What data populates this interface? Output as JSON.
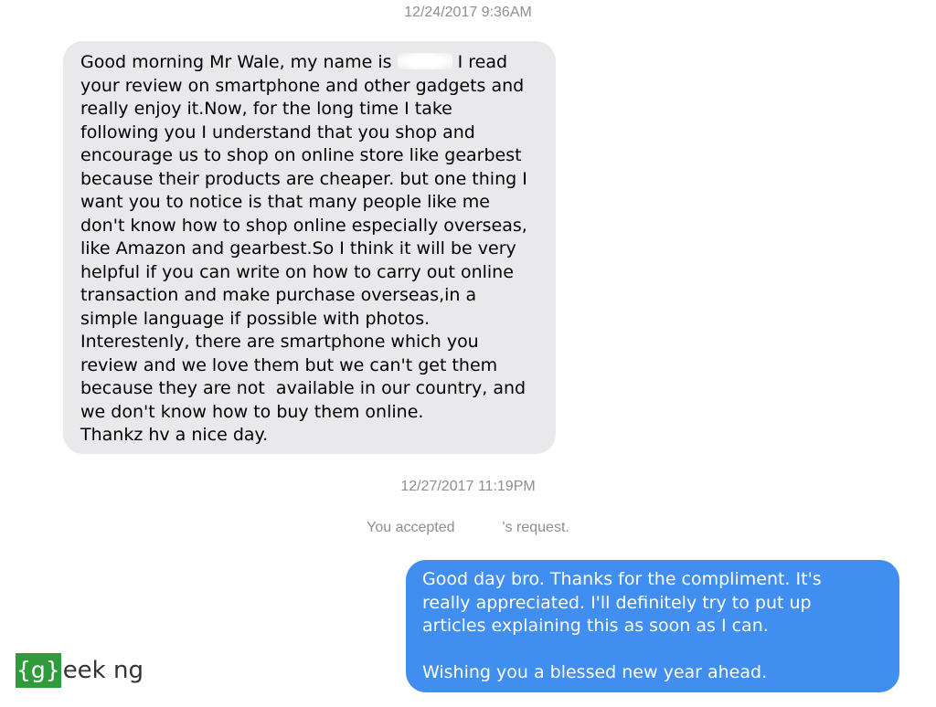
{
  "conversation": {
    "timestamp_1": "12/24/2017 9:36AM",
    "incoming_message": {
      "before_name": "Good morning Mr Wale, my name is ",
      "after_name": " I read\nyour review on smartphone and other gadgets and\nreally enjoy it.Now, for the long time I take\nfollowing you I understand that you shop and\nencourage us to shop on online store like gearbest\nbecause their products are cheaper. but one thing I\nwant you to notice is that many people like me\ndon't know how to shop online especially overseas,\nlike Amazon and gearbest.So I think it will be very\nhelpful if you can write on how to carry out online\ntransaction and make purchase overseas,in a\nsimple language if possible with photos.\nInterestenly, there are smartphone which you\nreview and we love them but we can't get them\nbecause they are not  available in our country, and\nwe don't know how to buy them online.\nThankz hv a nice day."
    },
    "timestamp_2": "12/27/2017 11:19PM",
    "system_note": {
      "before": "You accepted",
      "after": "'s request."
    },
    "outgoing_message": "Good day bro. Thanks for the compliment. It's\nreally appreciated. I'll definitely try to put up\narticles explaining this as soon as I can.\n\nWishing you a blessed new year ahead."
  },
  "watermark": {
    "bracket_text": "{g}",
    "rest_text": "eek ng"
  },
  "colors": {
    "incoming_bubble": "#e9e9eb",
    "outgoing_bubble": "#3f8ef0",
    "meta_text": "#8e8e93",
    "logo_green": "#2f9b3a"
  }
}
